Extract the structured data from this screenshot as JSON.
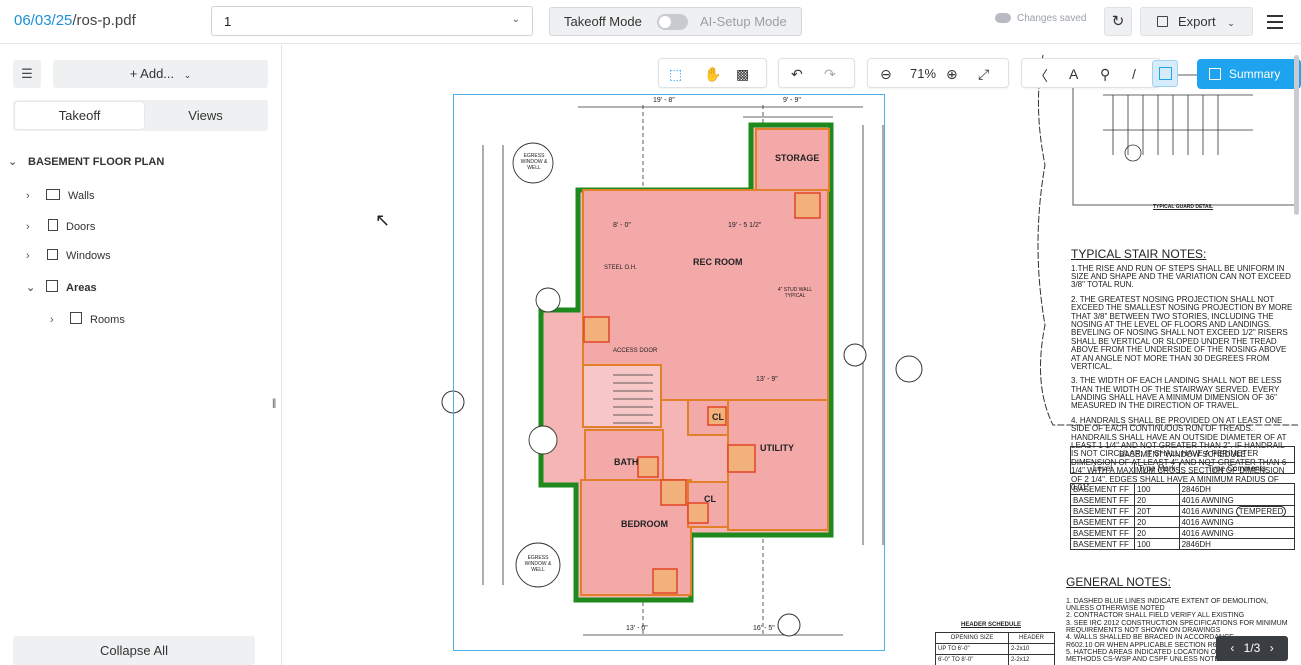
{
  "header": {
    "file_date": "06/03/25",
    "file_name": "/ros-p.pdf",
    "page_select_value": "1",
    "mode_labels": {
      "takeoff": "Takeoff Mode",
      "ai_setup": "AI-Setup Mode"
    },
    "save_status": "Changes saved",
    "export_label": "Export"
  },
  "sidebar": {
    "add_label": "+   Add...",
    "tabs": [
      {
        "label": "Takeoff"
      },
      {
        "label": "Views"
      }
    ],
    "tree": {
      "root": "BASEMENT FLOOR PLAN",
      "items": [
        {
          "label": "Walls"
        },
        {
          "label": "Doors"
        },
        {
          "label": "Windows"
        },
        {
          "label": "Areas"
        },
        {
          "label": "Rooms"
        }
      ]
    },
    "collapse_label": "Collapse All"
  },
  "toolbar": {
    "zoom": "71%",
    "summary_label": "Summary",
    "page_indicator": "1/3"
  },
  "drawing": {
    "rooms": [
      "STORAGE",
      "REC ROOM",
      "UTILITY",
      "BATH",
      "BEDROOM",
      "CL",
      "CL"
    ],
    "labels": [
      "STEEL O.H.",
      "ACCESS DOOR",
      "EGRESS WINDOW & WELL",
      "4\" STUD WALL TYPICAL"
    ],
    "dimensions": [
      "19' - 8\"",
      "9' - 9\"",
      "19' - 5 1/2\"",
      "8' - 0\"",
      "13' - 9\"",
      "13' - 0\"",
      "16' - 5\""
    ],
    "guard_detail": "TYPICAL GUARD DETAIL",
    "stair_notes_title": "TYPICAL STAIR NOTES:",
    "stair_notes": [
      "1.THE RISE AND RUN OF STEPS SHALL BE UNIFORM IN SIZE AND SHAPE AND THE VARIATION CAN NOT EXCEED 3/8\" TOTAL RUN.",
      "2. THE GREATEST NOSING PROJECTION SHALL NOT EXCEED THE SMALLEST NOSING PROJECTION BY MORE THAT 3/8\" BETWEEN TWO STORIES, INCLUDING THE NOSING AT THE LEVEL OF FLOORS AND LANDINGS. BEVELING OF NOSING SHALL NOT EXCEED 1/2\" RISERS SHALL BE VERTICAL OR SLOPED UNDER THE TREAD ABOVE FROM THE UNDERSIDE OF THE NOSING ABOVE AT AN ANGLE NOT MORE THAN 30 DEGREES FROM VERTICAL.",
      "3. THE WIDTH OF EACH LANDING SHALL NOT BE LESS THAN THE WIDTH OF THE STAIRWAY SERVED. EVERY LANDING SHALL HAVE A MINIMUM DIMENSION OF 36\" MEASURED IN THE DIRECTION OF TRAVEL.",
      "4. HANDRAILS SHALL BE PROVIDED ON AT LEAST ONE SIDE OF EACH CONTINUOUS RUN OF TREADS. HANDRAILS SHALL HAVE AN OUTSIDE DIAMETER OF AT LEAST 1 1/4\" AND NOT GREATER THAN 2\". IF HANDRAIL IS NOT CIRCULAR, IT SHALL HAVE A PERIMETER DIMENSION OF AT LEAST 4\" AND NOT GREATER THAN 6 1/4\" WITH A MAXIMUM CROSS SECTION OF DIMENSION OF 2 1/4\". EDGES SHALL HAVE A MINIMUM RADIUS OF 0.01\"."
    ],
    "window_schedule": {
      "title": "BASEMENT WINDOW SCHEDULE",
      "columns": [
        "Level",
        "Type Mark",
        "Type Comments"
      ],
      "rows": [
        [
          "BASEMENT FF",
          "100",
          "2846DH"
        ],
        [
          "BASEMENT FF",
          "20",
          "4016 AWNING"
        ],
        [
          "BASEMENT FF",
          "20T",
          "4016 AWNING"
        ],
        [
          "BASEMENT FF",
          "20",
          "4016 AWNING"
        ],
        [
          "BASEMENT FF",
          "20",
          "4016 AWNING"
        ],
        [
          "BASEMENT FF",
          "100",
          "2846DH"
        ]
      ],
      "tempered": "TEMPERED"
    },
    "general_notes_title": "GENERAL NOTES:",
    "general_notes": [
      "1. DASHED BLUE LINES INDICATE EXTENT OF DEMOLITION, UNLESS OTHERWISE NOTED",
      "2. CONTRACTOR SHALL FIELD VERIFY ALL EXISTING",
      "3. SEE IRC 2012 CONSTRUCTION SPECIFICATIONS FOR MINIMUM REQUIREMENTS NOT SHOWN ON DRAWINGS",
      "4. WALLS SHALLED BE BRACED IN ACCORDANCE",
      "R602.10 OR WHEN APPLICABLE SECTION R602.12",
      "5. HATCHED AREAS INDICATED LOCATION OF BRA",
      "METHODS CS-WSP AND CSPF UNLESS NOTED OT"
    ],
    "header_schedule": {
      "title": "HEADER SCHEDULE",
      "columns": [
        "OPENING SIZE",
        "HEADER"
      ],
      "rows": [
        [
          "UP TO 6'-0\"",
          "2-2x10"
        ],
        [
          "6'-0\" TO 8'-0\"",
          "2-2x12"
        ]
      ]
    }
  }
}
